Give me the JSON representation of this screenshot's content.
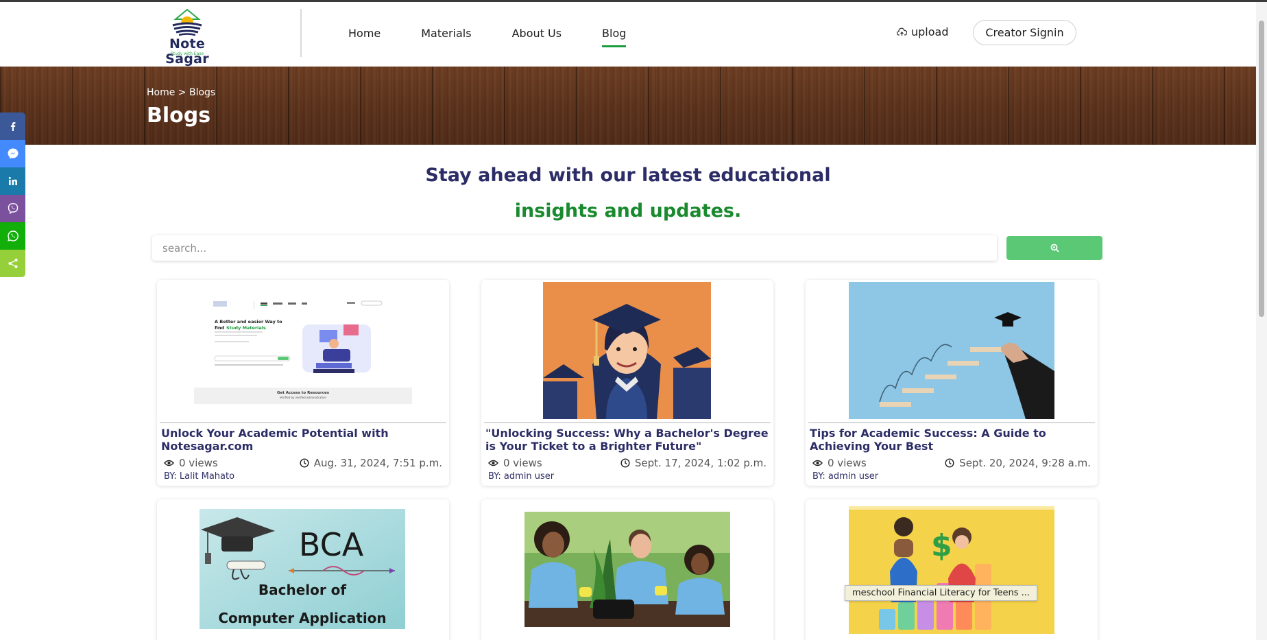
{
  "header": {
    "logo_name": "Note Sagar",
    "logo_tagline": "Study with Ease",
    "nav": [
      {
        "label": "Home"
      },
      {
        "label": "Materials"
      },
      {
        "label": "About Us"
      },
      {
        "label": "Blog"
      }
    ],
    "active_nav": "Blog",
    "upload_label": "upload",
    "signin_label": "Creator Signin"
  },
  "banner": {
    "breadcrumb": "Home > Blogs",
    "title": "Blogs"
  },
  "share_sidebar": [
    {
      "icon": "facebook-icon",
      "color": "#3b5998"
    },
    {
      "icon": "messenger-icon",
      "color": "#448aff"
    },
    {
      "icon": "linkedin-icon",
      "color": "#1a7baa"
    },
    {
      "icon": "viber-icon",
      "color": "#7b519d"
    },
    {
      "icon": "whatsapp-icon",
      "color": "#12af0a"
    },
    {
      "icon": "share-icon",
      "color": "#95d03a"
    }
  ],
  "headline": {
    "line1": "Stay ahead with our latest educational",
    "line2": "insights and updates."
  },
  "search": {
    "placeholder": "search...",
    "value": ""
  },
  "posts": [
    {
      "title": "Unlock Your Academic Potential with Notesagar.com",
      "views": "0 views",
      "date": "Aug. 31, 2024, 7:51 p.m.",
      "author": "BY: Lalit Mahato"
    },
    {
      "title": "\"Unlocking Success: Why a Bachelor's Degree is Your Ticket to a Brighter Future\"",
      "views": "0 views",
      "date": "Sept. 17, 2024, 1:02 p.m.",
      "author": "BY: admin user"
    },
    {
      "title": "Tips for Academic Success: A Guide to Achieving Your Best",
      "views": "0 views",
      "date": "Sept. 20, 2024, 9:28 a.m.",
      "author": "BY: admin user"
    },
    {
      "title": "",
      "views": "",
      "date": "",
      "author": ""
    },
    {
      "title": "",
      "views": "",
      "date": "",
      "author": ""
    },
    {
      "title": "",
      "views": "",
      "date": "",
      "author": ""
    }
  ],
  "post_images": {
    "bca_text_1": "BCA",
    "bca_text_2": "Bachelor of",
    "bca_text_3": "Computer Application",
    "thumb1_heading_1": "A Better and easier Way to",
    "thumb1_heading_2": "find",
    "thumb1_heading_3": "Study Materials",
    "thumb1_footer_1": "Get Access to Resources",
    "thumb1_footer_2": "Verified by verified administration"
  },
  "tooltip": "meschool Financial Literacy for Teens ...",
  "colors": {
    "brand_navy": "#2c2d66",
    "brand_green": "#1a8a2e",
    "search_button": "#5bc876"
  }
}
